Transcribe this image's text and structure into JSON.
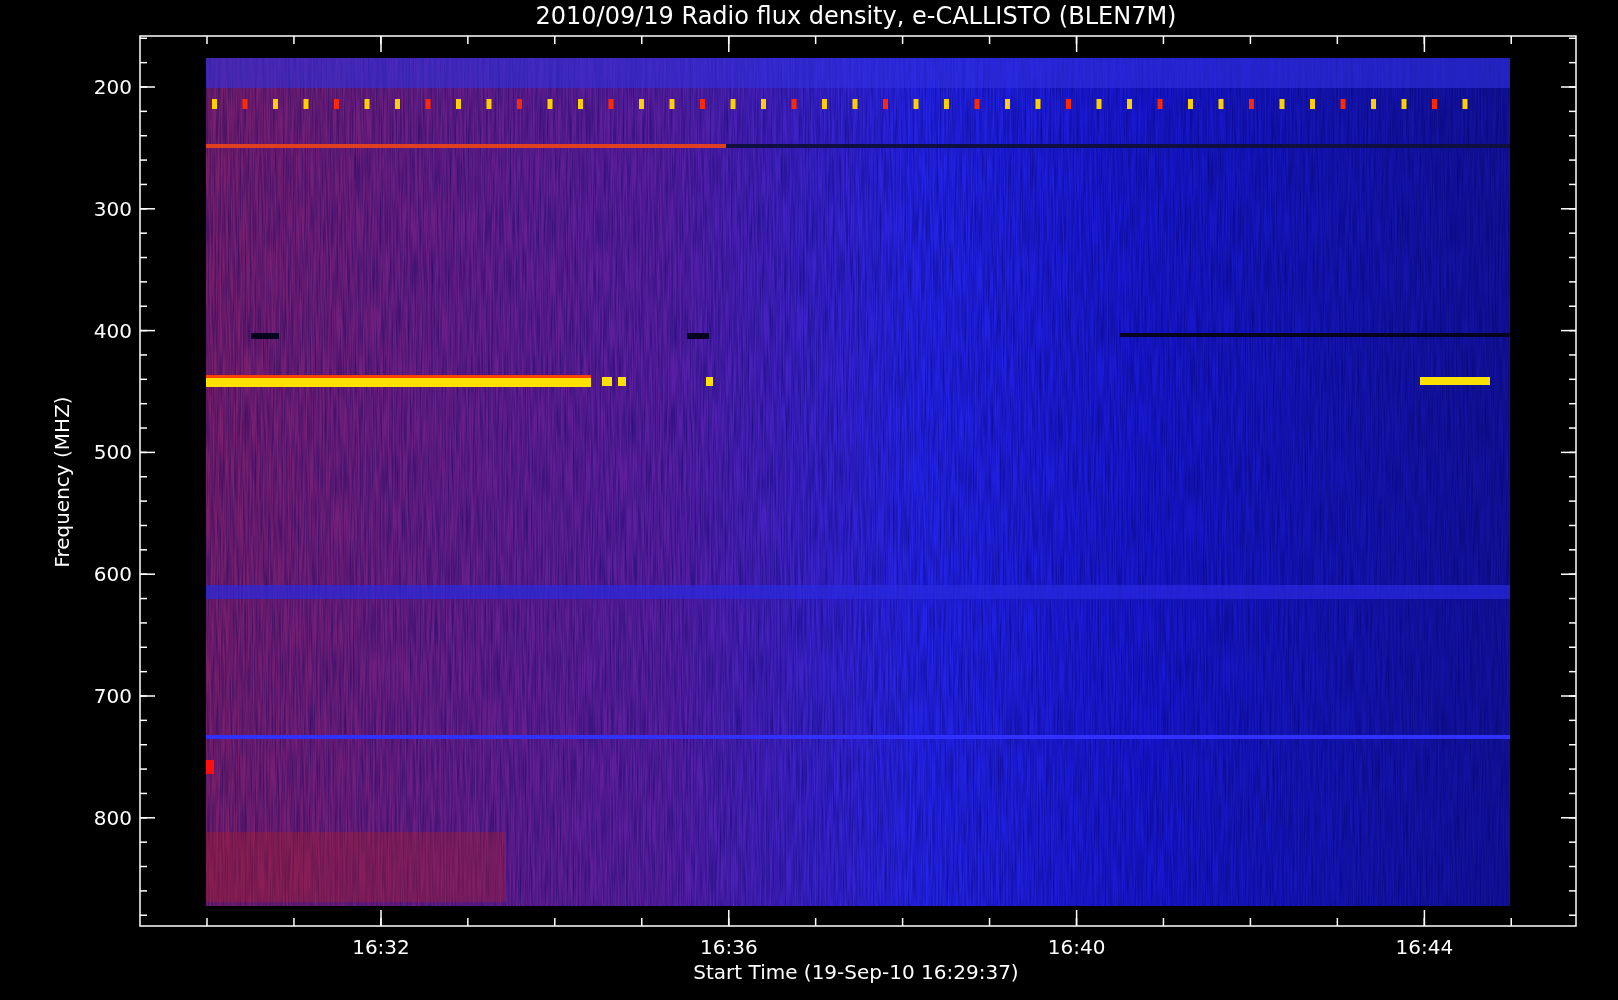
{
  "title": "2010/09/19  Radio flux density, e-CALLISTO (BLEN7M)",
  "y_axis": {
    "label": "Frequency (MHZ)",
    "ticks": [
      "200",
      "300",
      "400",
      "500",
      "600",
      "700",
      "800"
    ]
  },
  "x_axis": {
    "label": "Start Time (19-Sep-10 16:29:37)",
    "ticks": [
      "16:32",
      "16:36",
      "16:40",
      "16:44"
    ]
  }
}
